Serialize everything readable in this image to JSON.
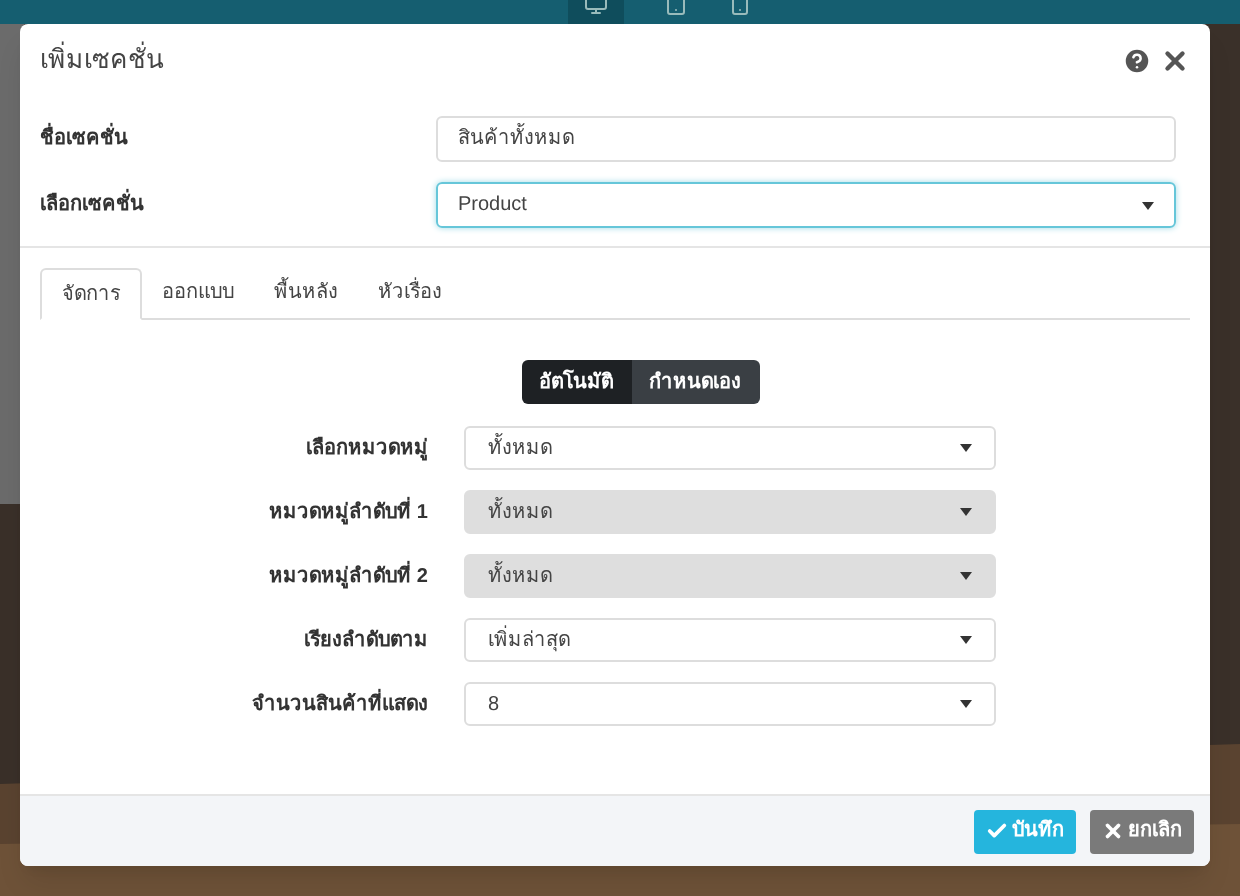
{
  "dialog": {
    "title": "เพิ่มเซคชั่น",
    "fields": [
      {
        "label": "ชื่อเซคชั่น",
        "kind": "text",
        "value": "สินค้าทั้งหมด"
      },
      {
        "label": "เลือกเซคชั่น",
        "kind": "select",
        "value": "Product",
        "focused": true
      }
    ],
    "tabs": [
      {
        "label": "จัดการ",
        "selected": true
      },
      {
        "label": "ออกแบบ",
        "selected": false
      },
      {
        "label": "พื้นหลัง",
        "selected": false
      },
      {
        "label": "หัวเรื่อง",
        "selected": false
      }
    ],
    "mode_toggle": [
      {
        "label": "อัตโนมัติ",
        "selected": true
      },
      {
        "label": "กำหนดเอง",
        "selected": false
      }
    ],
    "settings": [
      {
        "label": "เลือกหมวดหมู่",
        "value": "ทั้งหมด",
        "disabled": false
      },
      {
        "label": "หมวดหมู่ลำดับที่ 1",
        "value": "ทั้งหมด",
        "disabled": true
      },
      {
        "label": "หมวดหมู่ลำดับที่ 2",
        "value": "ทั้งหมด",
        "disabled": true
      },
      {
        "label": "เรียงลำดับตาม",
        "value": "เพิ่มล่าสุด",
        "disabled": false
      },
      {
        "label": "จำนวนสินค้าที่แสดง",
        "value": "8",
        "disabled": false
      }
    ],
    "buttons": [
      {
        "kind": "save",
        "label": "บันทึก"
      },
      {
        "kind": "cancel",
        "label": "ยกเลิก"
      }
    ]
  }
}
